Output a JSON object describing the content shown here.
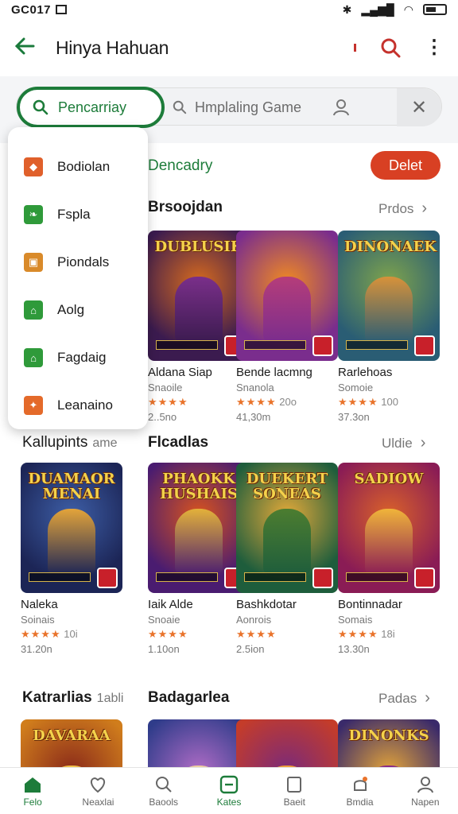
{
  "status_bar": {
    "time": "GC017"
  },
  "app_bar": {
    "title": "Hinya Hahuan"
  },
  "search": {
    "pill_label": "Pencarriay",
    "placeholder": "Hmplaling Game"
  },
  "header_row": {
    "heading": "Dencadry",
    "delete_label": "Delet"
  },
  "menu": {
    "items": [
      {
        "label": "Bodiolan",
        "icon": "tag-icon",
        "color": "#e0602b"
      },
      {
        "label": "Fspla",
        "icon": "leaf-icon",
        "color": "#2f9a3a"
      },
      {
        "label": "Piondals",
        "icon": "puzzle-icon",
        "color": "#d98a2a"
      },
      {
        "label": "Aolg",
        "icon": "bank-icon",
        "color": "#2f9a3a"
      },
      {
        "label": "Fagdaig",
        "icon": "bank-icon",
        "color": "#2f9a3a"
      },
      {
        "label": "Leanaino",
        "icon": "controller-icon",
        "color": "#e46a2a"
      }
    ]
  },
  "sections": [
    {
      "title": "Brsoojdan",
      "more": "Prdos",
      "cards": [
        {
          "thumb_title": "DUBLUSIK",
          "name": "Aldana Siap",
          "sub": "Snaoile",
          "rating": "",
          "size": "2..5no",
          "colors": [
            "#3b1b4f",
            "#d66a1e",
            "#7a2f8a"
          ]
        },
        {
          "thumb_title": "",
          "name": "Bende lacmng",
          "sub": "Snanola",
          "rating": "20o",
          "size": "41,30m",
          "colors": [
            "#7a2d8d",
            "#f08a22",
            "#b53d7a"
          ]
        },
        {
          "thumb_title": "DINONAEK",
          "name": "Rarlehoas",
          "sub": "Somoie",
          "rating": "100",
          "size": "37.3on",
          "colors": [
            "#2a5d74",
            "#7fa44c",
            "#d7923a"
          ]
        }
      ]
    },
    {
      "title": "Flcadlas",
      "more": "Uldie",
      "cards": [
        {
          "thumb_title": "DUAMAOR MENAI",
          "name": "Naleka",
          "sub": "Soinais",
          "rating": "10i",
          "size": "31.20n",
          "colors": [
            "#1c2556",
            "#3d5ea6",
            "#e3a43a"
          ]
        },
        {
          "thumb_title": "PHAOKK HUSHAIS",
          "name": "Iaik Alde",
          "sub": "Snoaie",
          "rating": "",
          "size": "1.10on",
          "colors": [
            "#4a1c70",
            "#d8531e",
            "#e3b13a"
          ]
        },
        {
          "thumb_title": "DUEKERT SONEAS",
          "name": "Bashkdotar",
          "sub": "Aonrois",
          "rating": "",
          "size": "2.5ion",
          "colors": [
            "#1e5d3c",
            "#e3a93a",
            "#4c7d30"
          ]
        },
        {
          "thumb_title": "SADIOW",
          "name": "Bontinnadar",
          "sub": "Somais",
          "rating": "18i",
          "size": "13.30n",
          "colors": [
            "#8a1c55",
            "#d9612a",
            "#f0b43a"
          ]
        }
      ]
    },
    {
      "title": "Badagarlea",
      "more": "Padas",
      "cards": [
        {
          "thumb_title": "DAVARAA",
          "colors": [
            "#d07d1c",
            "#8a2a1a",
            "#f2c14a"
          ]
        },
        {
          "thumb_title": "",
          "colors": [
            "#2f3c8a",
            "#b06cc6",
            "#f0d0a0"
          ]
        },
        {
          "thumb_title": "",
          "colors": [
            "#c43c2a",
            "#7a2a7a",
            "#f0a03a"
          ]
        },
        {
          "thumb_title": "DINONKS",
          "colors": [
            "#3a2a6a",
            "#e3a43a",
            "#8a2a8a"
          ]
        }
      ]
    }
  ],
  "left_section": {
    "title": "Kallupints",
    "sub": "ame"
  },
  "third_left_title": {
    "title": "Katrarlias",
    "sub": "1abli"
  },
  "bottom_nav": [
    {
      "label": "Felo",
      "icon": "home-icon"
    },
    {
      "label": "Neaxlai",
      "icon": "heart-icon"
    },
    {
      "label": "Baools",
      "icon": "search-icon"
    },
    {
      "label": "Kates",
      "icon": "games-icon"
    },
    {
      "label": "Baeit",
      "icon": "book-icon"
    },
    {
      "label": "Bmdia",
      "icon": "notification-icon"
    },
    {
      "label": "Napen",
      "icon": "profile-icon"
    }
  ]
}
